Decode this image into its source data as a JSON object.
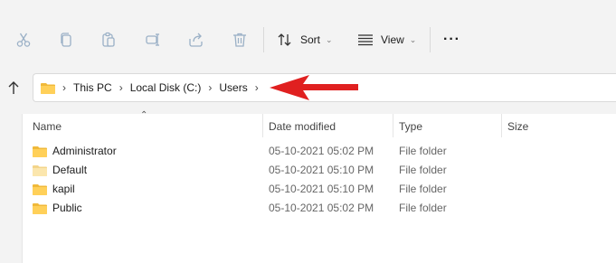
{
  "toolbar": {
    "icons": [
      "cut-icon",
      "copy-icon",
      "paste-icon",
      "rename-icon",
      "share-icon",
      "delete-icon"
    ],
    "sort_label": "Sort",
    "view_label": "View",
    "more_label": "···"
  },
  "address": {
    "crumbs": [
      "This PC",
      "Local Disk (C:)",
      "Users"
    ],
    "arrow_color": "#e02020"
  },
  "columns": {
    "name": "Name",
    "date": "Date modified",
    "type": "Type",
    "size": "Size"
  },
  "rows": [
    {
      "name": "Administrator",
      "date": "05-10-2021 05:02 PM",
      "type": "File folder"
    },
    {
      "name": "Default",
      "date": "05-10-2021 05:10 PM",
      "type": "File folder"
    },
    {
      "name": "kapil",
      "date": "05-10-2021 05:10 PM",
      "type": "File folder"
    },
    {
      "name": "Public",
      "date": "05-10-2021 05:02 PM",
      "type": "File folder"
    }
  ]
}
